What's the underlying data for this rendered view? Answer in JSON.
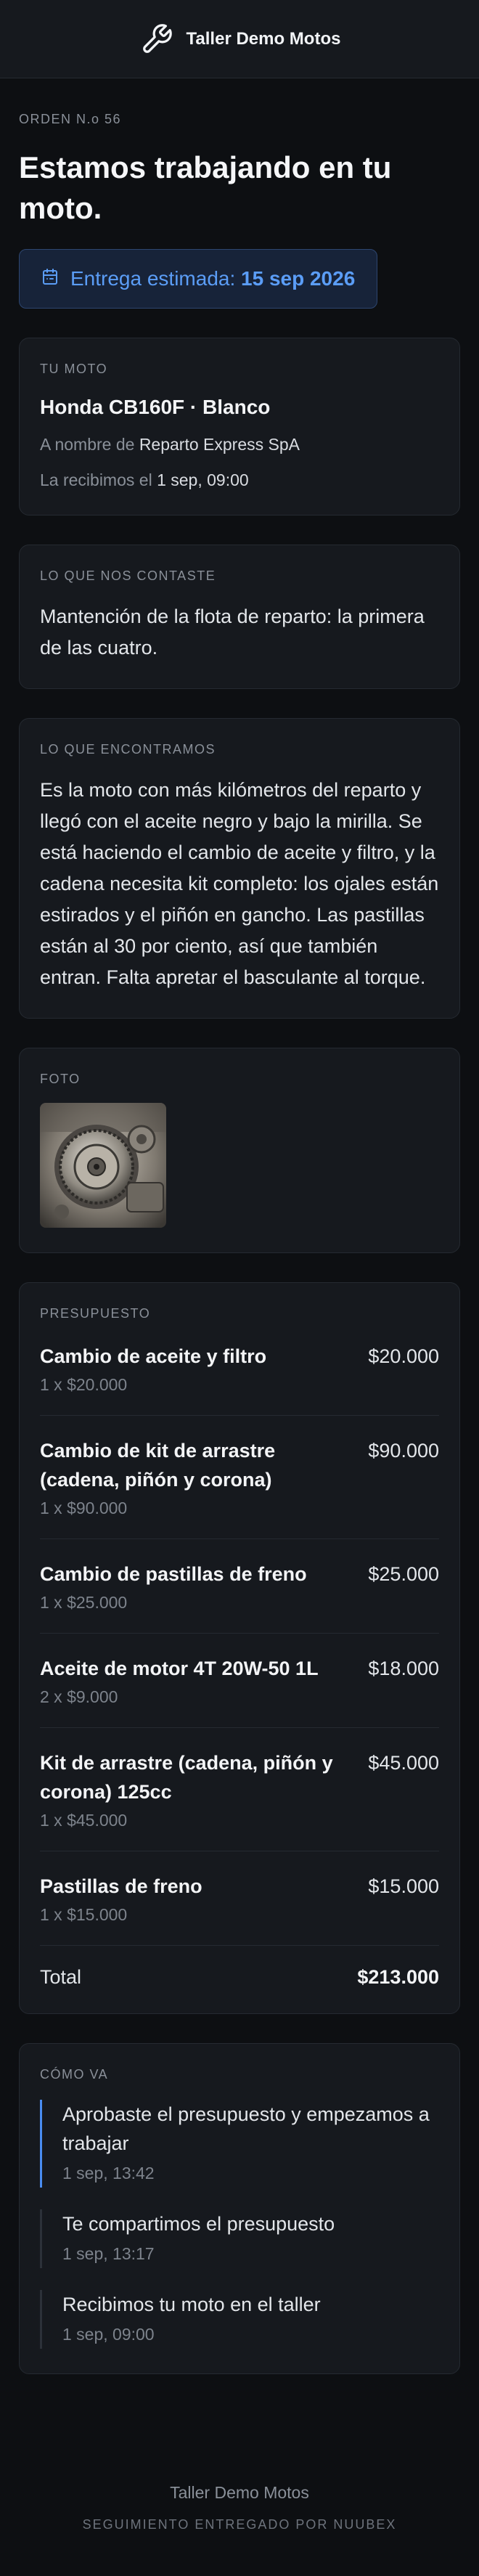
{
  "header": {
    "brand": "Taller Demo Motos",
    "logo_icon": "wrench-icon"
  },
  "order": {
    "label": "ORDEN N.o 56",
    "title": "Estamos trabajando en tu moto.",
    "eta_label": "Entrega estimada:",
    "eta_date": "15 sep 2026",
    "eta_icon": "calendar-icon",
    "accent": "#5b9df6"
  },
  "moto": {
    "label": "TU MOTO",
    "name": "Honda CB160F · Blanco",
    "owner_prefix": "A nombre de",
    "owner": "Reparto Express SpA",
    "received_prefix": "La recibimos el",
    "received": "1 sep, 09:00"
  },
  "told": {
    "label": "LO QUE NOS CONTASTE",
    "text": "Mantención de la flota de reparto: la primera de las cuatro."
  },
  "found": {
    "label": "LO QUE ENCONTRAMOS",
    "text": "Es la moto con más kilómetros del reparto y llegó con el aceite negro y bajo la mirilla. Se está haciendo el cambio de aceite y filtro, y la cadena necesita kit completo: los ojales están estirados y el piñón en gancho. Las pastillas están al 30 por ciento, así que también entran. Falta apretar el basculante al torque."
  },
  "photo": {
    "label": "FOTO"
  },
  "budget": {
    "label": "PRESUPUESTO",
    "items": [
      {
        "name": "Cambio de aceite y filtro",
        "qty": "1 x $20.000",
        "price": "$20.000"
      },
      {
        "name": "Cambio de kit de arrastre (cadena, piñón y corona)",
        "qty": "1 x $90.000",
        "price": "$90.000"
      },
      {
        "name": "Cambio de pastillas de freno",
        "qty": "1 x $25.000",
        "price": "$25.000"
      },
      {
        "name": "Aceite de motor 4T 20W-50 1L",
        "qty": "2 x $9.000",
        "price": "$18.000"
      },
      {
        "name": "Kit de arrastre (cadena, piñón y corona) 125cc",
        "qty": "1 x $45.000",
        "price": "$45.000"
      },
      {
        "name": "Pastillas de freno",
        "qty": "1 x $15.000",
        "price": "$15.000"
      }
    ],
    "total_label": "Total",
    "total": "$213.000"
  },
  "progress": {
    "label": "CÓMO VA",
    "events": [
      {
        "text": "Aprobaste el presupuesto y empezamos a trabajar",
        "time": "1 sep, 13:42"
      },
      {
        "text": "Te compartimos el presupuesto",
        "time": "1 sep, 13:17"
      },
      {
        "text": "Recibimos tu moto en el taller",
        "time": "1 sep, 09:00"
      }
    ]
  },
  "footer": {
    "name": "Taller Demo Motos",
    "powered": "SEGUIMIENTO ENTREGADO POR NUUBEX"
  }
}
